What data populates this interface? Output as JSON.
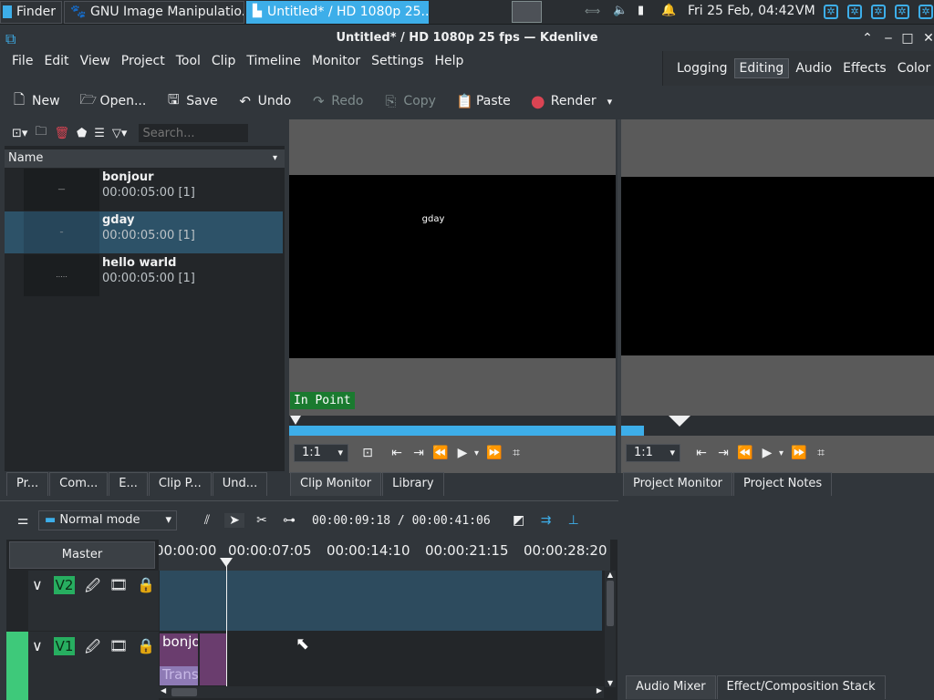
{
  "taskbar": {
    "tasks": [
      {
        "label": "Finder"
      },
      {
        "label": "GNU Image Manipulatio..."
      },
      {
        "label": "Untitled* / HD 1080p 25..."
      }
    ],
    "clock": "Fri 25 Feb, 04:42",
    "keyboard": "VM"
  },
  "window": {
    "title": "Untitled* / HD 1080p 25 fps — Kdenlive"
  },
  "menu": [
    "File",
    "Edit",
    "View",
    "Project",
    "Tool",
    "Clip",
    "Timeline",
    "Monitor",
    "Settings",
    "Help"
  ],
  "layouts": [
    "Logging",
    "Editing",
    "Audio",
    "Effects",
    "Color"
  ],
  "layout_active": "Editing",
  "toolbar": {
    "new": "New",
    "open": "Open...",
    "save": "Save",
    "undo": "Undo",
    "redo": "Redo",
    "copy": "Copy",
    "paste": "Paste",
    "render": "Render"
  },
  "bin": {
    "search_placeholder": "Search...",
    "column_header": "Name",
    "clips": [
      {
        "name": "bonjour",
        "duration": "00:00:05:00 [1]",
        "thumb": "—"
      },
      {
        "name": "gday",
        "duration": "00:00:05:00 [1]",
        "thumb": "–"
      },
      {
        "name": "hello warld",
        "duration": "00:00:05:00 [1]",
        "thumb": "....."
      }
    ],
    "tabs": [
      "Pr...",
      "Com...",
      "E...",
      "Clip P...",
      "Und..."
    ]
  },
  "clip_monitor": {
    "overlay_text": "gday",
    "in_point": "In Point",
    "zoom": "1:1",
    "tabs": [
      "Clip Monitor",
      "Library"
    ]
  },
  "project_monitor": {
    "zoom": "1:1",
    "tabs": [
      "Project Monitor",
      "Project Notes"
    ]
  },
  "timeline": {
    "mode": "Normal mode",
    "timecode": "00:00:09:18 / 00:00:41:06",
    "master": "Master",
    "ruler": [
      "00:00:00",
      "00:00:07:05",
      "00:00:14:10",
      "00:00:21:15",
      "00:00:28:20"
    ],
    "tracks": [
      {
        "name": "V2"
      },
      {
        "name": "V1"
      }
    ],
    "clips": [
      {
        "label": "bonjo"
      },
      {
        "label": "Trans"
      }
    ]
  },
  "lower_right_tabs": [
    "Audio Mixer",
    "Effect/Composition Stack"
  ]
}
